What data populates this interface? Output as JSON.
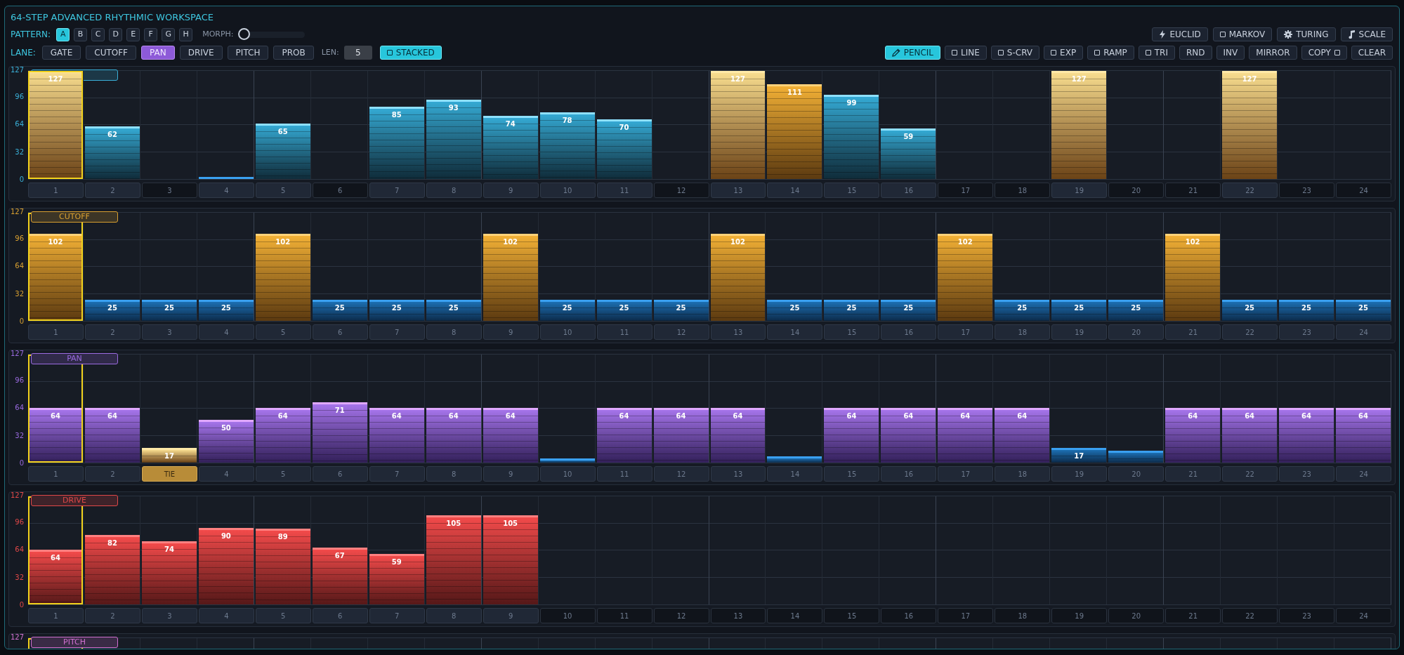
{
  "window": {
    "title": "64-STEP ADVANCED RHYTHMIC WORKSPACE"
  },
  "pattern": {
    "label": "PATTERN:",
    "items": [
      {
        "label": "A",
        "selected": true
      },
      {
        "label": "B",
        "selected": false
      },
      {
        "label": "C",
        "selected": false
      },
      {
        "label": "D",
        "selected": false
      },
      {
        "label": "E",
        "selected": false
      },
      {
        "label": "F",
        "selected": false
      },
      {
        "label": "G",
        "selected": false
      },
      {
        "label": "H",
        "selected": false
      }
    ]
  },
  "morph": {
    "label": "MORPH:",
    "level": 0
  },
  "lane_select": {
    "label": "LANE:",
    "items": [
      {
        "label": "GATE",
        "selected": false
      },
      {
        "label": "CUTOFF",
        "selected": false
      },
      {
        "label": "PAN",
        "selected": true
      },
      {
        "label": "DRIVE",
        "selected": false
      },
      {
        "label": "PITCH",
        "selected": false
      },
      {
        "label": "PROB",
        "selected": false
      }
    ]
  },
  "length": {
    "label": "LEN:",
    "value": "5"
  },
  "stacked": {
    "label": "STACKED",
    "on": true
  },
  "generators": [
    {
      "label": "EUCLID",
      "kind": "bolt"
    },
    {
      "label": "MARKOV",
      "kind": "square"
    },
    {
      "label": "TURING",
      "kind": "gear"
    },
    {
      "label": "SCALE",
      "kind": "note"
    }
  ],
  "tools": [
    {
      "label": "PENCIL",
      "kind": "pencil",
      "selected": true
    },
    {
      "label": "LINE",
      "kind": "square",
      "selected": false
    },
    {
      "label": "S-CRV",
      "kind": "square",
      "selected": false
    },
    {
      "label": "EXP",
      "kind": "square",
      "selected": false
    },
    {
      "label": "RAMP",
      "kind": "square",
      "selected": false
    },
    {
      "label": "TRI",
      "kind": "square",
      "selected": false
    },
    {
      "label": "RND",
      "kind": "plain",
      "selected": false
    },
    {
      "label": "INV",
      "kind": "plain",
      "selected": false
    },
    {
      "label": "MIRROR",
      "kind": "plain",
      "selected": false
    },
    {
      "label": "COPY",
      "kind": "trailing",
      "selected": false
    },
    {
      "label": "CLEAR",
      "kind": "plain",
      "selected": false
    }
  ],
  "lanes": [
    {
      "color": "#3ab0d8",
      "yticks": [
        "127",
        "96",
        "64",
        "32",
        "0"
      ],
      "steps": [
        {
          "label": "1",
          "on": true,
          "selected": true,
          "level": 1,
          "value": "127",
          "kind": "gold"
        },
        {
          "label": "2",
          "on": true,
          "selected": false,
          "level": 0.488,
          "value": "62",
          "kind": "teal"
        },
        {
          "label": "3",
          "on": false,
          "selected": false
        },
        {
          "label": "4",
          "on": true,
          "selected": false,
          "level": 0.02,
          "kind": "blue"
        },
        {
          "label": "5",
          "on": true,
          "selected": false,
          "level": 0.512,
          "value": "65",
          "kind": "teal"
        },
        {
          "label": "6",
          "on": false,
          "selected": false
        },
        {
          "label": "7",
          "on": true,
          "selected": false,
          "level": 0.669,
          "value": "85",
          "kind": "teal"
        },
        {
          "label": "8",
          "on": true,
          "selected": false,
          "level": 0.732,
          "value": "93",
          "kind": "teal"
        },
        {
          "label": "9",
          "on": true,
          "selected": false,
          "level": 0.583,
          "value": "74",
          "kind": "teal"
        },
        {
          "label": "10",
          "on": true,
          "selected": false,
          "level": 0.614,
          "value": "78",
          "kind": "teal"
        },
        {
          "label": "11",
          "on": true,
          "selected": false,
          "level": 0.551,
          "value": "70",
          "kind": "teal"
        },
        {
          "label": "12",
          "on": false,
          "selected": false
        },
        {
          "label": "13",
          "on": true,
          "selected": false,
          "level": 1,
          "value": "127",
          "kind": "gold"
        },
        {
          "label": "14",
          "on": true,
          "selected": false,
          "level": 0.874,
          "value": "111",
          "kind": "amber"
        },
        {
          "label": "15",
          "on": true,
          "selected": false,
          "level": 0.78,
          "value": "99",
          "kind": "teal"
        },
        {
          "label": "16",
          "on": true,
          "selected": false,
          "level": 0.465,
          "value": "59",
          "kind": "teal"
        },
        {
          "label": "17",
          "on": false,
          "selected": false
        },
        {
          "label": "18",
          "on": false,
          "selected": false
        },
        {
          "label": "19",
          "on": true,
          "selected": false,
          "level": 1,
          "value": "127",
          "kind": "gold"
        },
        {
          "label": "20",
          "on": false,
          "selected": false
        },
        {
          "label": "21",
          "on": false,
          "selected": false
        },
        {
          "label": "22",
          "on": true,
          "selected": false,
          "level": 1,
          "value": "127",
          "kind": "gold"
        },
        {
          "label": "23",
          "on": false,
          "selected": false
        },
        {
          "label": "24",
          "on": false,
          "selected": false
        }
      ]
    },
    {
      "name": "CUTOFF",
      "color": "#d9a030",
      "yticks": [
        "127",
        "96",
        "64",
        "32",
        "0"
      ],
      "steps": [
        {
          "label": "1",
          "on": true,
          "selected": true,
          "level": 0.803,
          "value": "102",
          "kind": "amber"
        },
        {
          "label": "2",
          "on": true,
          "selected": false,
          "level": 0.197,
          "value": "25",
          "kind": "blue"
        },
        {
          "label": "3",
          "on": true,
          "selected": false,
          "level": 0.197,
          "value": "25",
          "kind": "blue"
        },
        {
          "label": "4",
          "on": true,
          "selected": false,
          "level": 0.197,
          "value": "25",
          "kind": "blue"
        },
        {
          "label": "5",
          "on": true,
          "selected": false,
          "level": 0.803,
          "value": "102",
          "kind": "amber"
        },
        {
          "label": "6",
          "on": true,
          "selected": false,
          "level": 0.197,
          "value": "25",
          "kind": "blue"
        },
        {
          "label": "7",
          "on": true,
          "selected": false,
          "level": 0.197,
          "value": "25",
          "kind": "blue"
        },
        {
          "label": "8",
          "on": true,
          "selected": false,
          "level": 0.197,
          "value": "25",
          "kind": "blue"
        },
        {
          "label": "9",
          "on": true,
          "selected": false,
          "level": 0.803,
          "value": "102",
          "kind": "amber"
        },
        {
          "label": "10",
          "on": true,
          "selected": false,
          "level": 0.197,
          "value": "25",
          "kind": "blue"
        },
        {
          "label": "11",
          "on": true,
          "selected": false,
          "level": 0.197,
          "value": "25",
          "kind": "blue"
        },
        {
          "label": "12",
          "on": true,
          "selected": false,
          "level": 0.197,
          "value": "25",
          "kind": "blue"
        },
        {
          "label": "13",
          "on": true,
          "selected": false,
          "level": 0.803,
          "value": "102",
          "kind": "amber"
        },
        {
          "label": "14",
          "on": true,
          "selected": false,
          "level": 0.197,
          "value": "25",
          "kind": "blue"
        },
        {
          "label": "15",
          "on": true,
          "selected": false,
          "level": 0.197,
          "value": "25",
          "kind": "blue"
        },
        {
          "label": "16",
          "on": true,
          "selected": false,
          "level": 0.197,
          "value": "25",
          "kind": "blue"
        },
        {
          "label": "17",
          "on": true,
          "selected": false,
          "level": 0.803,
          "value": "102",
          "kind": "amber"
        },
        {
          "label": "18",
          "on": true,
          "selected": false,
          "level": 0.197,
          "value": "25",
          "kind": "blue"
        },
        {
          "label": "19",
          "on": true,
          "selected": false,
          "level": 0.197,
          "value": "25",
          "kind": "blue"
        },
        {
          "label": "20",
          "on": true,
          "selected": false,
          "level": 0.197,
          "value": "25",
          "kind": "blue"
        },
        {
          "label": "21",
          "on": true,
          "selected": false,
          "level": 0.803,
          "value": "102",
          "kind": "amber"
        },
        {
          "label": "22",
          "on": true,
          "selected": false,
          "level": 0.197,
          "value": "25",
          "kind": "blue"
        },
        {
          "label": "23",
          "on": true,
          "selected": false,
          "level": 0.197,
          "value": "25",
          "kind": "blue"
        },
        {
          "label": "24",
          "on": true,
          "selected": false,
          "level": 0.197,
          "value": "25",
          "kind": "blue"
        }
      ]
    },
    {
      "name": "PAN",
      "color": "#9a6ae0",
      "yticks": [
        "127",
        "96",
        "64",
        "32",
        "0"
      ],
      "steps": [
        {
          "label": "1",
          "on": true,
          "selected": true,
          "level": 0.504,
          "value": "64",
          "kind": "purple"
        },
        {
          "label": "2",
          "on": true,
          "selected": false,
          "level": 0.504,
          "value": "64",
          "kind": "purple"
        },
        {
          "label": "TIE",
          "on": true,
          "tie": true,
          "selected": false,
          "level": 0.134,
          "value": "17",
          "kind": "gold"
        },
        {
          "label": "4",
          "on": true,
          "selected": false,
          "level": 0.394,
          "value": "50",
          "kind": "purple"
        },
        {
          "label": "5",
          "on": true,
          "selected": false,
          "level": 0.504,
          "value": "64",
          "kind": "purple"
        },
        {
          "label": "6",
          "on": true,
          "selected": false,
          "level": 0.559,
          "value": "71",
          "kind": "purple"
        },
        {
          "label": "7",
          "on": true,
          "selected": false,
          "level": 0.504,
          "value": "64",
          "kind": "purple"
        },
        {
          "label": "8",
          "on": true,
          "selected": false,
          "level": 0.504,
          "value": "64",
          "kind": "purple"
        },
        {
          "label": "9",
          "on": true,
          "selected": false,
          "level": 0.504,
          "value": "64",
          "kind": "purple"
        },
        {
          "label": "10",
          "on": true,
          "selected": false,
          "level": 0.04,
          "kind": "blue"
        },
        {
          "label": "11",
          "on": true,
          "selected": false,
          "level": 0.504,
          "value": "64",
          "kind": "purple"
        },
        {
          "label": "12",
          "on": true,
          "selected": false,
          "level": 0.504,
          "value": "64",
          "kind": "purple"
        },
        {
          "label": "13",
          "on": true,
          "selected": false,
          "level": 0.504,
          "value": "64",
          "kind": "purple"
        },
        {
          "label": "14",
          "on": true,
          "selected": false,
          "level": 0.06,
          "kind": "blue"
        },
        {
          "label": "15",
          "on": true,
          "selected": false,
          "level": 0.504,
          "value": "64",
          "kind": "purple"
        },
        {
          "label": "16",
          "on": true,
          "selected": false,
          "level": 0.504,
          "value": "64",
          "kind": "purple"
        },
        {
          "label": "17",
          "on": true,
          "selected": false,
          "level": 0.504,
          "value": "64",
          "kind": "purple"
        },
        {
          "label": "18",
          "on": true,
          "selected": false,
          "level": 0.504,
          "value": "64",
          "kind": "purple"
        },
        {
          "label": "19",
          "on": true,
          "selected": false,
          "level": 0.134,
          "value": "17",
          "kind": "blue"
        },
        {
          "label": "20",
          "on": true,
          "selected": false,
          "level": 0.11,
          "kind": "blue"
        },
        {
          "label": "21",
          "on": true,
          "selected": false,
          "level": 0.504,
          "value": "64",
          "kind": "purple"
        },
        {
          "label": "22",
          "on": true,
          "selected": false,
          "level": 0.504,
          "value": "64",
          "kind": "purple"
        },
        {
          "label": "23",
          "on": true,
          "selected": false,
          "level": 0.504,
          "value": "64",
          "kind": "purple"
        },
        {
          "label": "24",
          "on": true,
          "selected": false,
          "level": 0.504,
          "value": "64",
          "kind": "purple"
        }
      ]
    },
    {
      "name": "DRIVE",
      "color": "#e04848",
      "yticks": [
        "127",
        "96",
        "64",
        "32",
        "0"
      ],
      "steps": [
        {
          "label": "1",
          "on": true,
          "selected": true,
          "level": 0.504,
          "value": "64",
          "kind": "red"
        },
        {
          "label": "2",
          "on": true,
          "selected": false,
          "level": 0.646,
          "value": "82",
          "kind": "red"
        },
        {
          "label": "3",
          "on": true,
          "selected": false,
          "level": 0.583,
          "value": "74",
          "kind": "red"
        },
        {
          "label": "4",
          "on": true,
          "selected": false,
          "level": 0.709,
          "value": "90",
          "kind": "red"
        },
        {
          "label": "5",
          "on": true,
          "selected": false,
          "level": 0.701,
          "value": "89",
          "kind": "red"
        },
        {
          "label": "6",
          "on": true,
          "selected": false,
          "level": 0.528,
          "value": "67",
          "kind": "red"
        },
        {
          "label": "7",
          "on": true,
          "selected": false,
          "level": 0.465,
          "value": "59",
          "kind": "red"
        },
        {
          "label": "8",
          "on": true,
          "selected": false,
          "level": 0.827,
          "value": "105",
          "kind": "red"
        },
        {
          "label": "9",
          "on": true,
          "selected": false,
          "level": 0.827,
          "value": "105",
          "kind": "red"
        },
        {
          "label": "10",
          "on": false,
          "selected": false
        },
        {
          "label": "11",
          "on": false,
          "selected": false
        },
        {
          "label": "12",
          "on": false,
          "selected": false
        },
        {
          "label": "13",
          "on": false,
          "selected": false
        },
        {
          "label": "14",
          "on": false,
          "selected": false
        },
        {
          "label": "15",
          "on": false,
          "selected": false
        },
        {
          "label": "16",
          "on": false,
          "selected": false
        },
        {
          "label": "17",
          "on": false,
          "selected": false
        },
        {
          "label": "18",
          "on": false,
          "selected": false
        },
        {
          "label": "19",
          "on": false,
          "selected": false
        },
        {
          "label": "20",
          "on": false,
          "selected": false
        },
        {
          "label": "21",
          "on": false,
          "selected": false
        },
        {
          "label": "22",
          "on": false,
          "selected": false
        },
        {
          "label": "23",
          "on": false,
          "selected": false
        },
        {
          "label": "24",
          "on": false,
          "selected": false
        }
      ]
    },
    {
      "name": "PITCH",
      "color": "#d070d0",
      "yticks": [
        "127"
      ],
      "steps": [
        {
          "selected": true
        },
        {
          "selected": false
        },
        {
          "selected": false
        },
        {
          "selected": false
        },
        {
          "selected": false
        },
        {
          "selected": false
        },
        {
          "selected": false
        },
        {
          "selected": false
        },
        {
          "selected": false
        },
        {
          "selected": false
        },
        {
          "selected": false
        },
        {
          "selected": false
        },
        {
          "selected": false
        },
        {
          "selected": false
        },
        {
          "selected": false
        },
        {
          "selected": false
        },
        {
          "selected": false
        },
        {
          "selected": false
        },
        {
          "selected": false
        },
        {
          "selected": false
        },
        {
          "selected": false
        },
        {
          "selected": false
        },
        {
          "selected": false
        },
        {
          "selected": false
        }
      ]
    }
  ]
}
